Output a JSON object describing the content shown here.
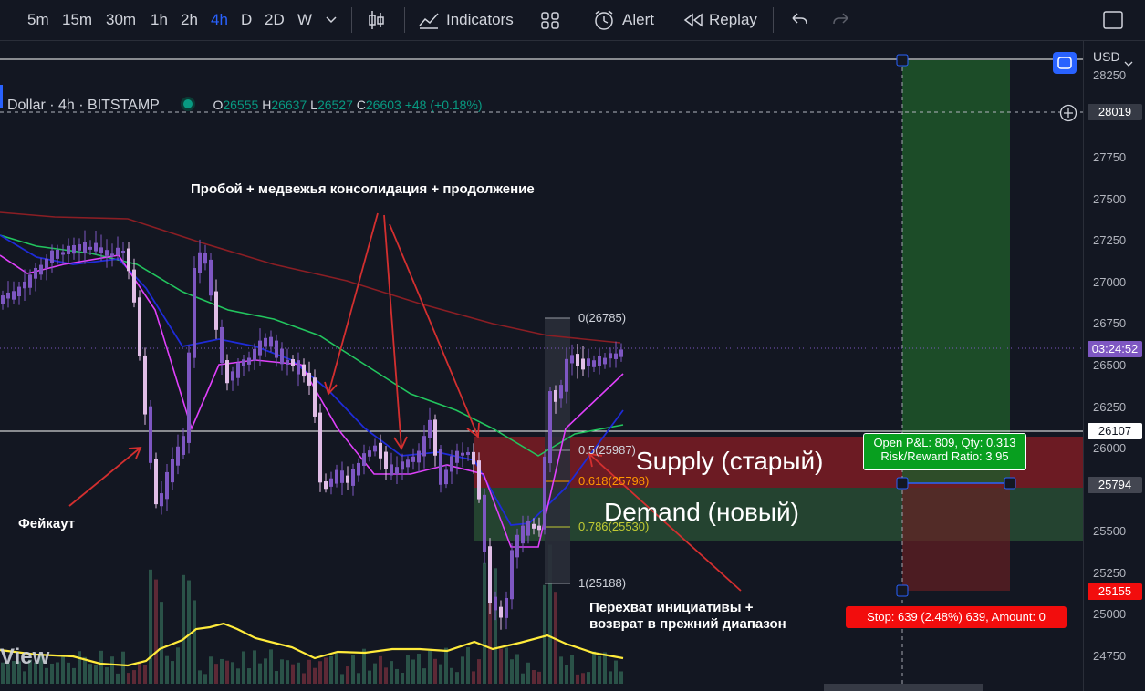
{
  "toolbar": {
    "intervals": [
      "5m",
      "15m",
      "30m",
      "1h",
      "2h",
      "4h",
      "D",
      "2D",
      "W"
    ],
    "active_interval": "4h",
    "indicators_label": "Indicators",
    "alert_label": "Alert",
    "replay_label": "Replay"
  },
  "legend": {
    "symbol": "Dollar · 4h · BITSTAMP",
    "o_label": "O",
    "o_value": "26555",
    "h_label": "H",
    "h_value": "26637",
    "l_label": "L",
    "l_value": "26527",
    "c_label": "C",
    "c_value": "26603",
    "change": "+48 (+0.18%)"
  },
  "axis": {
    "currency": "USD",
    "ticks": [
      "28250",
      "27750",
      "27500",
      "27250",
      "27000",
      "26750",
      "26500",
      "26250",
      "26000",
      "25500",
      "25250",
      "25000",
      "24750"
    ],
    "crosshair_price": "28019",
    "countdown": "03:24:52",
    "price_26107": "26107",
    "price_25794": "25794",
    "price_25155": "25155"
  },
  "annotations": {
    "top_text": "Пробой + медвежья консолидация + продолжение",
    "fakeout": "Фейкаут",
    "bottom_line1": "Перехват инициативы +",
    "bottom_line2": "возврат в прежний диапазон",
    "supply": "Supply (старый)",
    "demand": "Demand (новый)",
    "watermark": "View"
  },
  "fib": {
    "l0": "0(26785)",
    "l05": "0.5(25987)",
    "l0618": "0.618(25798)",
    "l0786": "0.786(25530)",
    "l1": "1(25188)"
  },
  "position": {
    "pnl": "Open P&L: 809, Qty: 0.313",
    "rr": "Risk/Reward Ratio: 3.95",
    "stop": "Stop: 639 (2.48%) 639, Amount: 0"
  },
  "colors": {
    "up": "#7e57c2",
    "down": "#e1bee7",
    "accent": "#2962ff"
  }
}
